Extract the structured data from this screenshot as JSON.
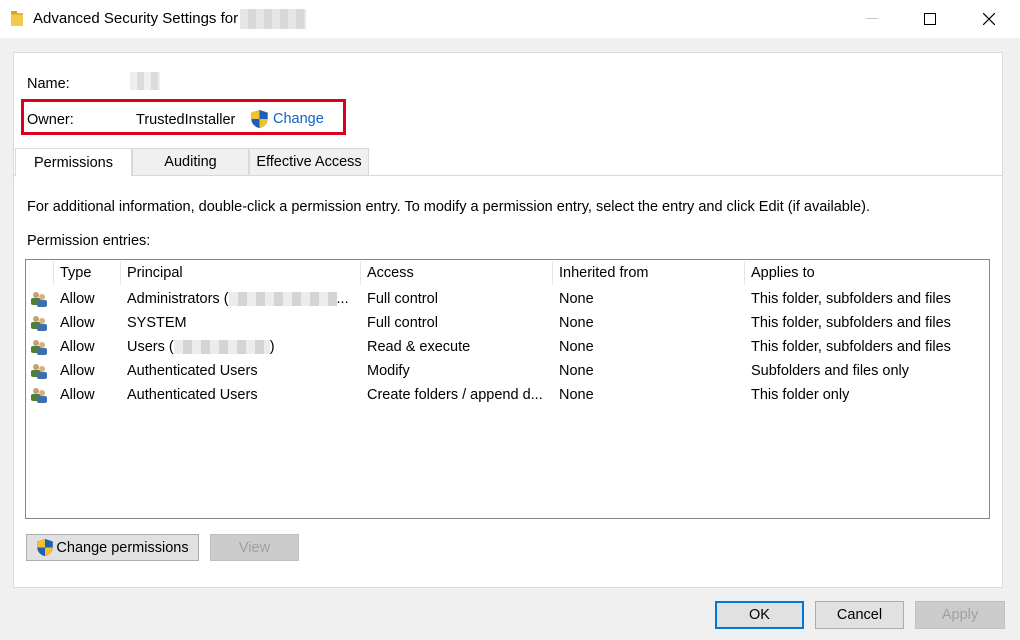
{
  "window": {
    "title": "Advanced Security Settings for",
    "icon": "folder-icon",
    "controls": [
      "minimize",
      "maximize",
      "close"
    ]
  },
  "info_section": {
    "name_label": "Name:",
    "owner_label": "Owner:",
    "owner_value": "TrustedInstaller",
    "change_link": "Change",
    "highlight_color": "#d9001b"
  },
  "tabs": [
    {
      "label": "Permissions",
      "active": true
    },
    {
      "label": "Auditing",
      "active": false
    },
    {
      "label": "Effective Access",
      "active": false
    }
  ],
  "info_text": "For additional information, double-click a permission entry. To modify a permission entry, select the entry and click Edit (if available).",
  "entries_label": "Permission entries:",
  "columns": [
    "Type",
    "Principal",
    "Access",
    "Inherited from",
    "Applies to"
  ],
  "rows": [
    {
      "type": "Allow",
      "principal": "Administrators (",
      "principal_suffix": "...",
      "access": "Full control",
      "inherited": "None",
      "applies": "This folder, subfolders and files"
    },
    {
      "type": "Allow",
      "principal": "SYSTEM",
      "principal_suffix": "",
      "access": "Full control",
      "inherited": "None",
      "applies": "This folder, subfolders and files"
    },
    {
      "type": "Allow",
      "principal": "Users (",
      "principal_suffix": ")",
      "access": "Read & execute",
      "inherited": "None",
      "applies": "This folder, subfolders and files"
    },
    {
      "type": "Allow",
      "principal": "Authenticated Users",
      "principal_suffix": "",
      "access": "Modify",
      "inherited": "None",
      "applies": "Subfolders and files only"
    },
    {
      "type": "Allow",
      "principal": "Authenticated Users",
      "principal_suffix": "",
      "access": "Create folders / append d...",
      "inherited": "None",
      "applies": "This folder only"
    }
  ],
  "buttons": {
    "change_permissions": "Change permissions",
    "view": "View",
    "ok": "OK",
    "cancel": "Cancel",
    "apply": "Apply"
  },
  "colors": {
    "link": "#0a64c8",
    "accent": "#0078d7"
  }
}
